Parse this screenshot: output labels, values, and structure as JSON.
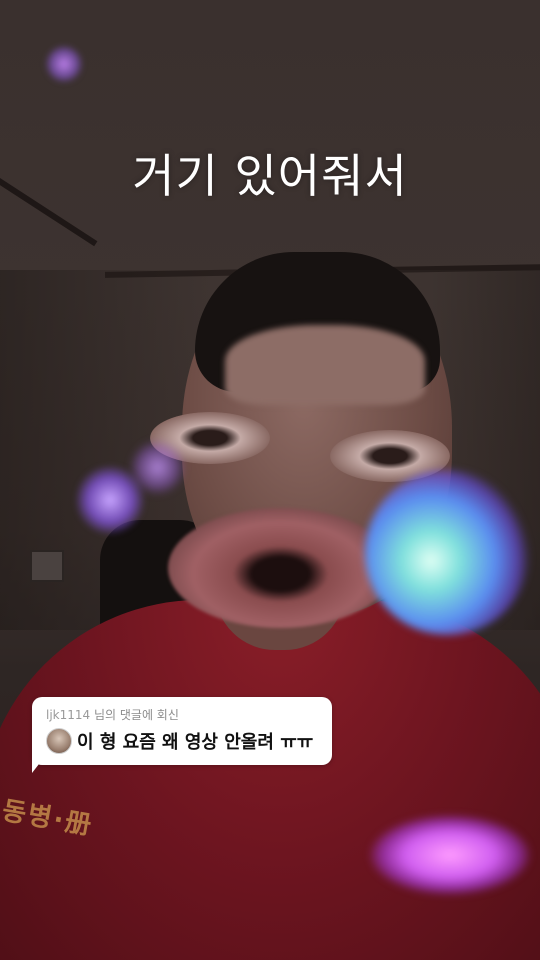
{
  "overlay": {
    "caption": "거기 있어줘서"
  },
  "reply": {
    "username": "ljk1114",
    "header_suffix": " 님의 댓글에 회신",
    "text": "이 형 요즘 왜 영상 안올려 ㅠㅠ"
  },
  "shirt": {
    "print_text": "동병·册"
  },
  "colors": {
    "reply_bubble_bg": "#ffffff",
    "caption_text": "#ffffff",
    "shirt_red": "#8a1e28"
  },
  "icons": {
    "reply_avatar": "user-avatar-icon"
  }
}
